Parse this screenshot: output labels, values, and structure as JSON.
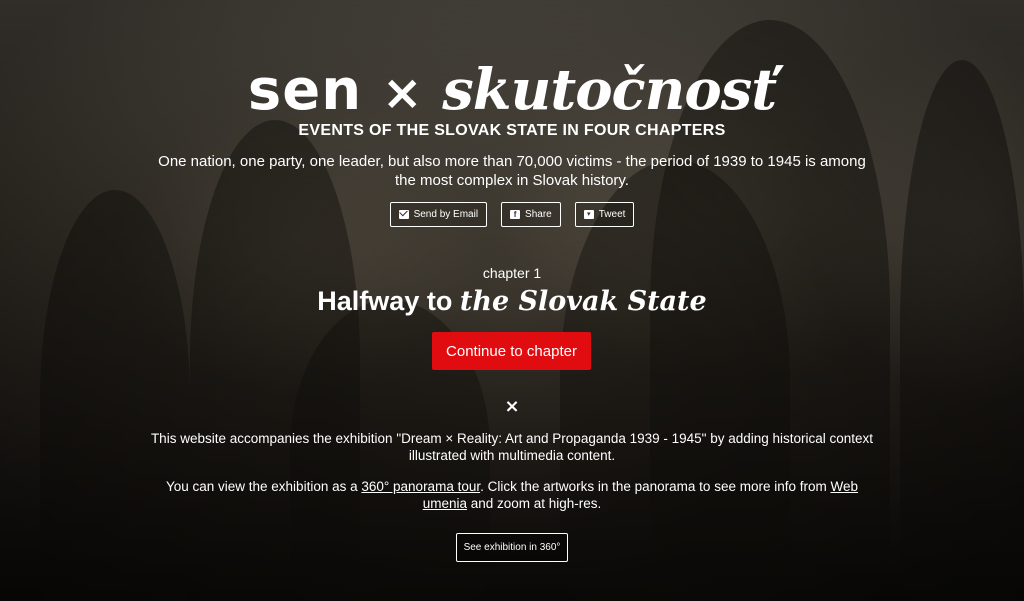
{
  "logo": {
    "part1": "sen",
    "separator": "×",
    "part2": "skutočnosť"
  },
  "subtitle": "EVENTS OF THE SLOVAK STATE IN FOUR CHAPTERS",
  "intro": "One nation, one party, one leader, but also more than 70,000 victims - the period of 1939 to 1945 is among the most complex in Slovak history.",
  "share": {
    "email": {
      "label": "Send by Email",
      "icon": "envelope-icon"
    },
    "facebook": {
      "label": "Share",
      "icon": "facebook-icon"
    },
    "twitter": {
      "label": "Tweet",
      "icon": "twitter-icon"
    }
  },
  "chapter": {
    "label": "chapter 1",
    "title_plain": "Halfway to",
    "title_blackletter": "the Slovak State",
    "continue_label": "Continue to chapter"
  },
  "divider": "×",
  "about": "This website accompanies the exhibition \"Dream × Reality: Art and Propaganda 1939 - 1945\" by adding historical context illustrated with multimedia content.",
  "view": {
    "prefix": "You can view the exhibition as a ",
    "panorama_link": "360° panorama tour",
    "middle": ". Click the artworks in the panorama to see more info from ",
    "webumenia_link": "Web umenia",
    "suffix": " and zoom at high-res."
  },
  "exhibition_button": "See exhibition in 360°",
  "colors": {
    "accent": "#e00c10",
    "text": "#ffffff"
  }
}
